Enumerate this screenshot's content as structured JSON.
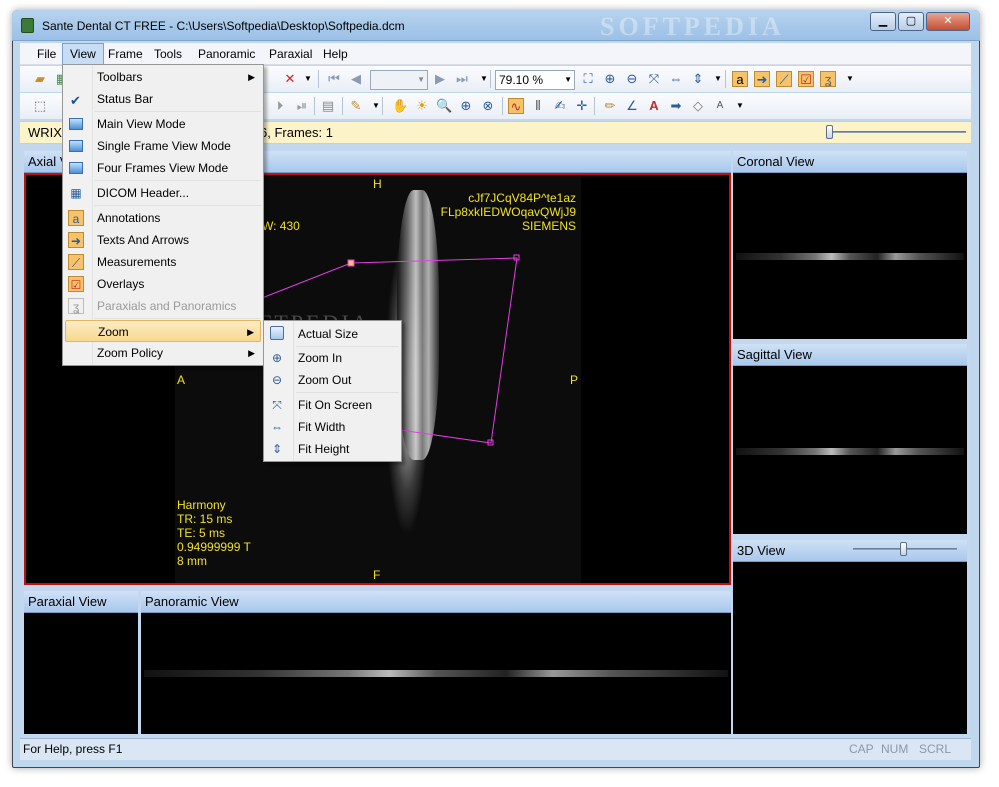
{
  "window": {
    "title": "Sante Dental CT FREE - C:\\Users\\Softpedia\\Desktop\\Softpedia.dcm",
    "watermark": "SOFTPEDIA",
    "controls": {
      "minimize": "▁",
      "maximize": "▢",
      "close": "✕"
    }
  },
  "menubar": [
    "File",
    "View",
    "Frame",
    "Tools",
    "Panoramic",
    "Paraxial",
    "Help"
  ],
  "toolbar": {
    "zoom_value": "79.10 %"
  },
  "infobar": {
    "prefix": "WRIX,",
    "frames": "6, Frames: 1"
  },
  "views": {
    "axial": {
      "title": "Axial V"
    },
    "coronal": {
      "title": "Coronal View"
    },
    "sagittal": {
      "title": "Sagittal View"
    },
    "threed": {
      "title": "3D View"
    },
    "paraxial": {
      "title": "Paraxial View"
    },
    "panoramic": {
      "title": "Panoramic View"
    }
  },
  "axial_overlay": {
    "top": "H",
    "bottom": "F",
    "left": "A",
    "right": "P",
    "window_text": "W: 430",
    "patient_id": "cJf7JCqV84P^te1az",
    "study": "FLp8xkIEDWOqavQWjJ9",
    "manufacturer": "SIEMENS",
    "bottom_info": [
      "Harmony",
      "TR: 15 ms",
      "TE: 5 ms",
      "0.94999999 T",
      "8 mm"
    ],
    "image_watermark": "SOFTPEDIA"
  },
  "view_menu": {
    "items": [
      {
        "label": "Toolbars",
        "submenu": true
      },
      {
        "label": "Status Bar",
        "checked": true
      },
      {
        "label": "Main View Mode"
      },
      {
        "label": "Single Frame View Mode"
      },
      {
        "label": "Four Frames View Mode"
      },
      {
        "label": "DICOM Header..."
      },
      {
        "label": "Annotations"
      },
      {
        "label": "Texts And Arrows"
      },
      {
        "label": "Measurements"
      },
      {
        "label": "Overlays"
      },
      {
        "label": "Paraxials and Panoramics",
        "disabled": true
      },
      {
        "label": "Zoom",
        "submenu": true,
        "highlighted": true
      },
      {
        "label": "Zoom Policy",
        "submenu": true
      }
    ]
  },
  "zoom_menu": {
    "items": [
      {
        "label": "Actual Size"
      },
      {
        "label": "Zoom In"
      },
      {
        "label": "Zoom Out"
      },
      {
        "label": "Fit On Screen"
      },
      {
        "label": "Fit Width"
      },
      {
        "label": "Fit Height"
      }
    ]
  },
  "statusbar": {
    "help": "For Help, press F1",
    "indicators": [
      "CAP",
      "NUM",
      "SCRL"
    ]
  },
  "colors": {
    "overlay_text": "#f2e21b",
    "roi_line": "#e23ee2",
    "active_frame": "#c01010",
    "view_header": "#a9c8ec"
  }
}
